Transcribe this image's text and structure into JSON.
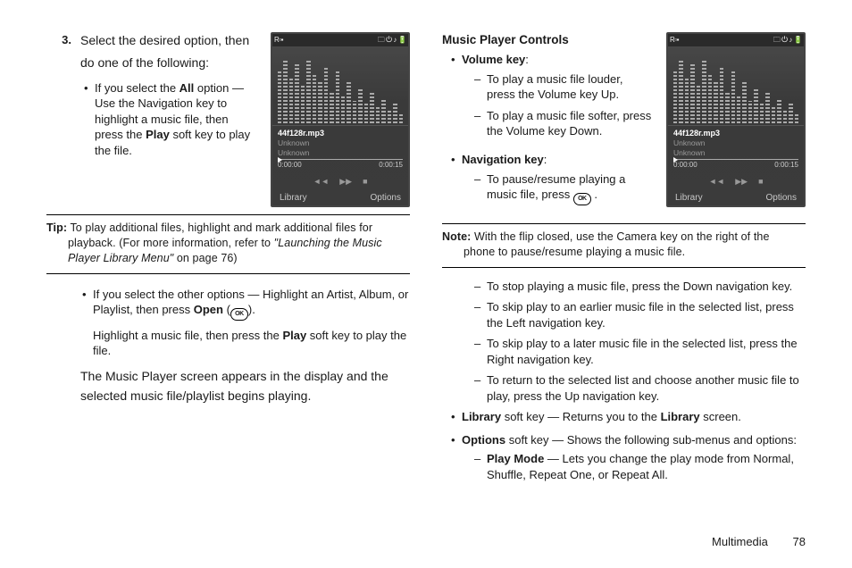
{
  "page_label": "Multimedia",
  "page_number": "78",
  "left": {
    "step_num": "3.",
    "step_line1": "Select the desired option, then",
    "step_line2": "do one of the following:",
    "bullet1_prefix": "If you select the ",
    "bullet1_bold1": "All",
    "bullet1_mid": " option — Use the Navigation key to highlight a music file, then press the ",
    "bullet1_bold2": "Play",
    "bullet1_suffix": " soft key to play the file.",
    "tip_label": "Tip:",
    "tip_text1": " To play additional files, highlight and mark additional files for playback. (For more information, refer to ",
    "tip_italic": "\"Launching the Music Player Library Menu\"",
    "tip_text2": "  on page 76)",
    "bullet2_prefix": "If you select the other options — Highlight an Artist, Album, or Playlist, then press ",
    "bullet2_bold": "Open",
    "bullet2_suffix": " (",
    "bullet2_close": ").",
    "bullet2_line2a": "Highlight a music file, then press the ",
    "bullet2_line2_bold": "Play",
    "bullet2_line2b": " soft key to play the file.",
    "result_text": "The Music Player screen appears in the display and the selected music file/playlist begins playing."
  },
  "right": {
    "heading": "Music Player Controls",
    "vol_label": "Volume key",
    "vol_d1": "To play a music file louder, press the Volume key Up.",
    "vol_d2": "To play a music file softer, press the Volume key Down.",
    "nav_label": "Navigation key",
    "nav_d1a": "To pause/resume playing a music file, press ",
    "nav_d1b": " .",
    "note_label": "Note:",
    "note_text": " With the flip closed, use the Camera key on the right of the phone to pause/resume playing a music file.",
    "d1": "To stop playing a music file, press the Down navigation key.",
    "d2": "To skip play to an earlier music file in the selected list, press the Left navigation key.",
    "d3": "To skip play to a later music file in the selected list, press the Right navigation key.",
    "d4": "To return to the selected list and choose another music file to play, press the Up navigation key.",
    "lib_bold": "Library",
    "lib_mid": " soft key — Returns you to the ",
    "lib_bold2": "Library",
    "lib_end": " screen.",
    "opt_bold": "Options",
    "opt_text": " soft key — Shows the following sub-menus and options:",
    "pm_bold": "Play Mode",
    "pm_text": " — Lets you change the play mode from Normal, Shuffle, Repeat One, or Repeat All."
  },
  "screenshot": {
    "status_left": "R▫▪",
    "status_right": "🗀 ⏻ ♪ 🔋",
    "track": "44f128r.mp3",
    "meta1": "Unknown",
    "meta2": "Unknown",
    "time_a": "0:00:00",
    "time_b": "0:00:15",
    "ctrl_prev": "◄◄",
    "ctrl_play": "▶▶",
    "ctrl_next": "■",
    "soft_left": "Library",
    "soft_right": "Options",
    "eq_bars": [
      60,
      72,
      50,
      66,
      42,
      70,
      55,
      48,
      62,
      36,
      58,
      30,
      46,
      25,
      40,
      22,
      34,
      18,
      28,
      14,
      24,
      11
    ]
  }
}
